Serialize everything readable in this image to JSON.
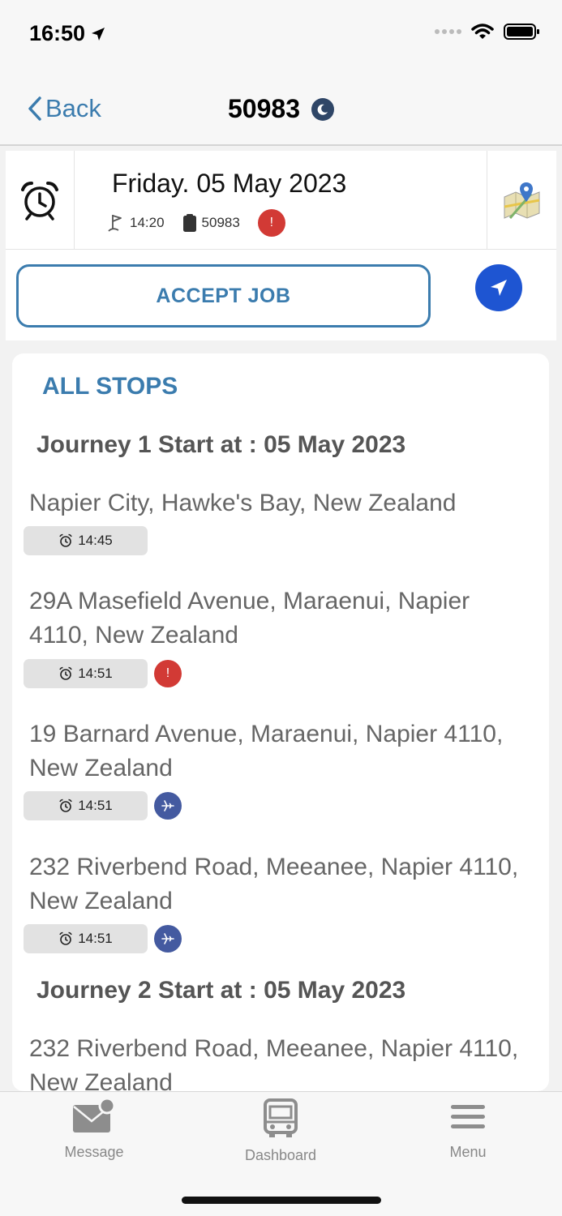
{
  "status_bar": {
    "time": "16:50",
    "colors": {
      "text": "#000000",
      "background": "#f7f7f7"
    }
  },
  "nav": {
    "back_label": "Back",
    "title": "50983",
    "colors": {
      "accent": "#3b7cae",
      "moon_badge": "#2f4667"
    }
  },
  "job": {
    "date": "Friday. 05 May 2023",
    "start_time": "14:20",
    "job_number": "50983",
    "alert_symbol": "!",
    "accept_label": "ACCEPT JOB",
    "icons": [
      "alarm-clock-icon",
      "map-icon",
      "flag-icon",
      "clipboard-icon",
      "navigation-arrow-icon"
    ],
    "colors": {
      "accent": "#3b7cae",
      "alert": "#d23a35",
      "navigate_button": "#1e55d2"
    }
  },
  "stops": {
    "heading": "ALL STOPS",
    "journeys": [
      {
        "heading": "Journey 1 Start at : 05 May 2023",
        "stops": [
          {
            "address": "Napier City, Hawke's Bay, New Zealand",
            "time": "14:45",
            "badge": "none"
          },
          {
            "address": "29A Masefield Avenue, Maraenui, Napier 4110, New Zealand",
            "time": "14:51",
            "badge": "alert",
            "badge_text": "!"
          },
          {
            "address": "19 Barnard Avenue, Maraenui, Napier 4110, New Zealand",
            "time": "14:51",
            "badge": "plane-icon"
          },
          {
            "address": "232 Riverbend Road, Meeanee, Napier 4110, New Zealand",
            "time": "14:51",
            "badge": "plane-icon"
          }
        ]
      },
      {
        "heading": "Journey 2 Start at : 05 May 2023",
        "stops": [
          {
            "address": "232 Riverbend Road, Meeanee, Napier 4110, New Zealand"
          }
        ]
      }
    ],
    "colors": {
      "heading": "#3b7cae",
      "journey_heading": "#555555",
      "address": "#666666",
      "chip": "#e2e2e2",
      "plane_badge": "#445aa0"
    }
  },
  "tabs": [
    {
      "label": "Message",
      "icon": "envelope-icon"
    },
    {
      "label": "Dashboard",
      "icon": "bus-icon"
    },
    {
      "label": "Menu",
      "icon": "hamburger-menu-icon"
    }
  ]
}
